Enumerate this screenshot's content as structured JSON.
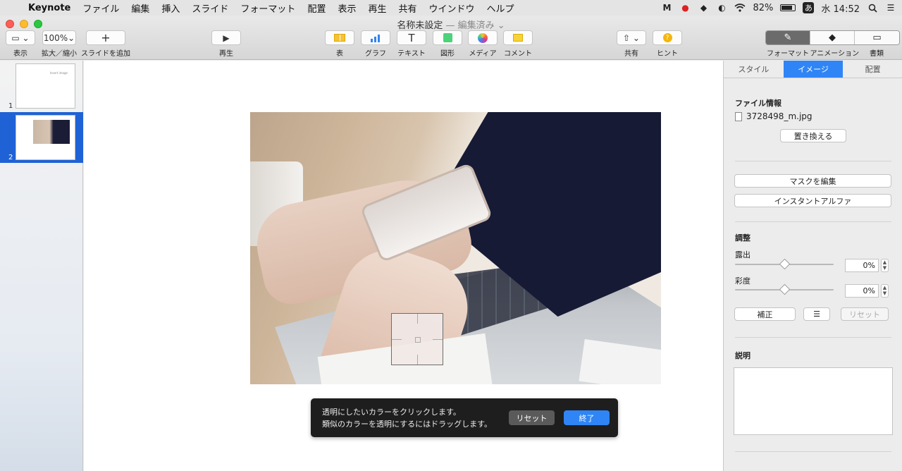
{
  "menubar": {
    "app": "Keynote",
    "items": [
      "ファイル",
      "編集",
      "挿入",
      "スライド",
      "フォーマット",
      "配置",
      "表示",
      "再生",
      "共有",
      "ウインドウ",
      "ヘルプ"
    ],
    "battery": "82%",
    "battery_level": 0.82,
    "ime": "あ",
    "clock": "水 14:52"
  },
  "window": {
    "title": "名称未設定",
    "subtitle": "— 編集済み ⌄"
  },
  "toolbar": {
    "view": "表示",
    "zoom_value": "100%",
    "zoom": "拡大／縮小",
    "add_slide": "スライドを追加",
    "play": "再生",
    "table": "表",
    "chart": "グラフ",
    "text": "テキスト",
    "shape": "図形",
    "media": "メディア",
    "comment": "コメント",
    "share": "共有",
    "tips": "ヒント",
    "format": "フォーマット",
    "animate": "アニメーション",
    "document": "書類"
  },
  "navigator": {
    "slides": [
      {
        "number": "1",
        "mini_text": "Insert image"
      },
      {
        "number": "2"
      }
    ]
  },
  "hud": {
    "line1": "透明にしたいカラーをクリックします。",
    "line2": "類似のカラーを透明にするにはドラッグします。",
    "reset": "リセット",
    "done": "終了"
  },
  "inspector": {
    "tabs": [
      "スタイル",
      "イメージ",
      "配置"
    ],
    "file_info": "ファイル情報",
    "file_name": "3728498_m.jpg",
    "replace": "置き換える",
    "edit_mask": "マスクを編集",
    "instant_alpha": "インスタントアルファ",
    "adjust": "調整",
    "exposure_label": "露出",
    "exposure_value": "0%",
    "exposure_level": 0.5,
    "saturation_label": "彩度",
    "saturation_value": "0%",
    "saturation_level": 0.5,
    "enhance": "補正",
    "reset": "リセット",
    "description": "説明"
  }
}
